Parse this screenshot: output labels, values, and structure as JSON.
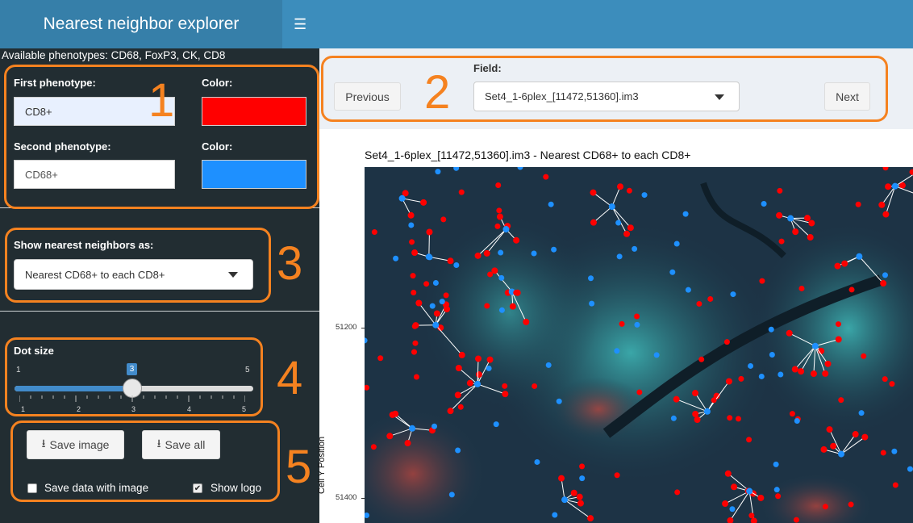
{
  "header": {
    "title": "Nearest neighbor explorer",
    "menu_icon": "hamburger-icon"
  },
  "sidebar": {
    "available_text": "Available phenotypes: CD68, FoxP3, CK, CD8",
    "first_label": "First phenotype:",
    "first_value": "CD8+",
    "color_label_1": "Color:",
    "color_1": "#ff0000",
    "second_label": "Second phenotype:",
    "second_value": "CD68+",
    "color_label_2": "Color:",
    "color_2": "#1e90ff",
    "show_as_label": "Show nearest neighbors as:",
    "show_as_value": "Nearest CD68+ to each CD8+",
    "dot_size_label": "Dot size",
    "dot_size": {
      "min": "1",
      "max": "5",
      "value": "3",
      "ticks": [
        "1",
        "2",
        "3",
        "4",
        "5"
      ]
    },
    "save_image_label": "Save image",
    "save_all_label": "Save all",
    "save_data_label": "Save data with image",
    "save_data_checked": false,
    "show_logo_label": "Show logo",
    "show_logo_checked": true
  },
  "annotations": {
    "n1": "1",
    "n2": "2",
    "n3": "3",
    "n4": "4",
    "n5": "5",
    "accent": "#f58220"
  },
  "main": {
    "previous_label": "Previous",
    "next_label": "Next",
    "field_label": "Field:",
    "field_value": "Set4_1-6plex_[11472,51360].im3",
    "plot_title": "Set4_1-6plex_[11472,51360].im3 - Nearest CD68+ to each CD8+",
    "y_axis_label": "Cell Y Position",
    "y_ticks": [
      "51200",
      "51400"
    ]
  }
}
